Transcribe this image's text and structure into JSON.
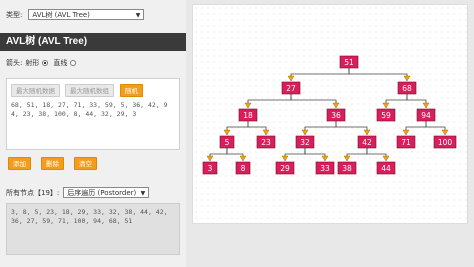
{
  "header": {
    "type_label": "类型:",
    "type_value": "AVL树 (AVL Tree)"
  },
  "title": "AVL树 (AVL Tree)",
  "arrow": {
    "label": "箭头:",
    "option1": "射形",
    "option2": "直线",
    "selected": "射形"
  },
  "buttons": {
    "max_random_data": "最大随机数据",
    "max_random_count": "最大随机数组",
    "random": "随机",
    "add": "添加",
    "delete": "删除",
    "clear": "清空"
  },
  "input_numbers": "68, 51, 18, 27, 71, 33, 59, 5, 36, 42, 94, 23, 38, 100, 8, 44, 32, 29, 3",
  "nodes_summary": {
    "label": "所有节点【19】:",
    "order": "后序遍历 (Postorder)"
  },
  "output": "3, 8, 5, 23, 18, 29, 33, 32, 38, 44, 42, 36, 27, 59, 71, 100, 94, 68, 51",
  "tree": {
    "node_color": "#d81e5b",
    "arrow_color": "#f2a20f",
    "nodes": [
      {
        "id": "n51",
        "label": "51"
      },
      {
        "id": "n27",
        "label": "27"
      },
      {
        "id": "n68",
        "label": "68"
      },
      {
        "id": "n18",
        "label": "18"
      },
      {
        "id": "n36",
        "label": "36"
      },
      {
        "id": "n59",
        "label": "59"
      },
      {
        "id": "n94",
        "label": "94"
      },
      {
        "id": "n5",
        "label": "5"
      },
      {
        "id": "n23",
        "label": "23"
      },
      {
        "id": "n32",
        "label": "32"
      },
      {
        "id": "n42",
        "label": "42"
      },
      {
        "id": "n71",
        "label": "71"
      },
      {
        "id": "n100",
        "label": "100"
      },
      {
        "id": "n3",
        "label": "3"
      },
      {
        "id": "n8",
        "label": "8"
      },
      {
        "id": "n29",
        "label": "29"
      },
      {
        "id": "n33",
        "label": "33"
      },
      {
        "id": "n38",
        "label": "38"
      },
      {
        "id": "n44",
        "label": "44"
      }
    ],
    "edges": [
      [
        "n51",
        "n27"
      ],
      [
        "n51",
        "n68"
      ],
      [
        "n27",
        "n18"
      ],
      [
        "n27",
        "n36"
      ],
      [
        "n68",
        "n59"
      ],
      [
        "n68",
        "n94"
      ],
      [
        "n18",
        "n5"
      ],
      [
        "n18",
        "n23"
      ],
      [
        "n36",
        "n32"
      ],
      [
        "n36",
        "n42"
      ],
      [
        "n94",
        "n71"
      ],
      [
        "n94",
        "n100"
      ],
      [
        "n5",
        "n3"
      ],
      [
        "n5",
        "n8"
      ],
      [
        "n32",
        "n29"
      ],
      [
        "n32",
        "n33"
      ],
      [
        "n42",
        "n38"
      ],
      [
        "n42",
        "n44"
      ]
    ]
  }
}
